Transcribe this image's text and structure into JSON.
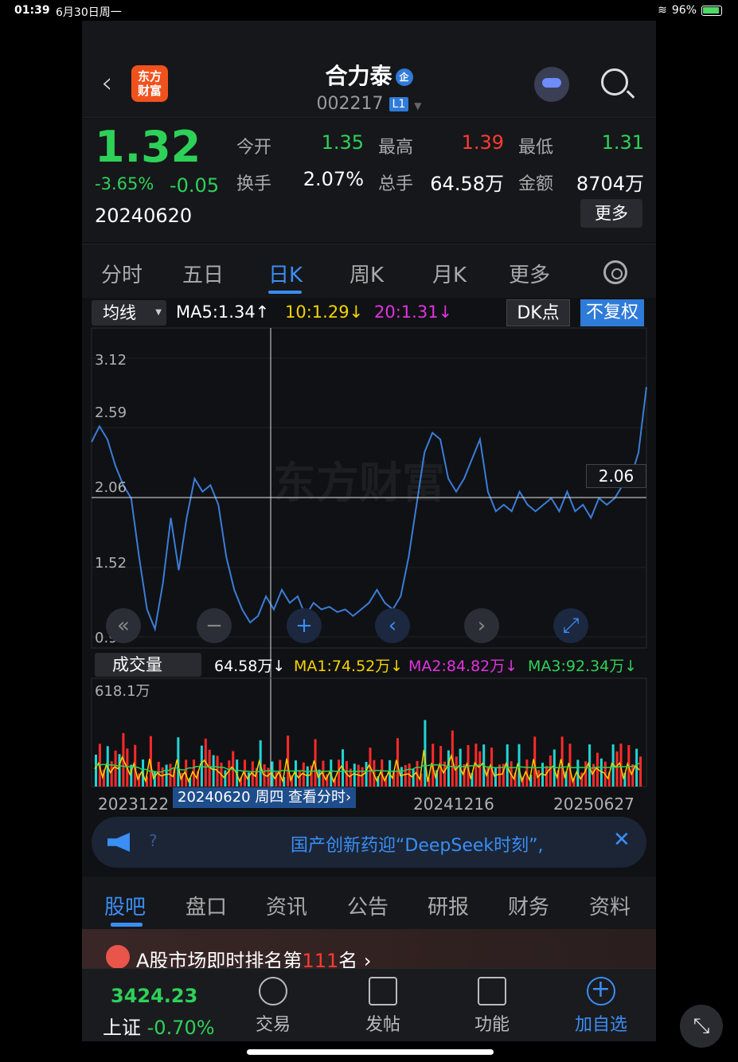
{
  "status": {
    "time": "01:39",
    "date": "6月30日周一",
    "battery": "96%"
  },
  "header": {
    "back": "‹",
    "logo_line1": "东方",
    "logo_line2": "财富",
    "title": "合力泰",
    "badge_qi": "企",
    "code": "002217",
    "level": "L1"
  },
  "quote": {
    "price": "1.32",
    "change_pct": "-3.65%",
    "change": "-0.05",
    "date": "20240620",
    "labels": {
      "open": "今开",
      "high": "最高",
      "low": "最低",
      "turnover": "换手",
      "volume": "总手",
      "amount": "金额"
    },
    "values": {
      "open": "1.35",
      "high": "1.39",
      "low": "1.31",
      "turnover": "2.07%",
      "volume": "64.58万",
      "amount": "8704万"
    },
    "more": "更多"
  },
  "ktabs": [
    "分时",
    "五日",
    "日K",
    "周K",
    "月K",
    "更多"
  ],
  "ma_bar": {
    "selector": "均线",
    "ma5": "MA5:1.34↑",
    "ma10": "10:1.29↓",
    "ma20": "20:1.31↓",
    "dk": "DK点",
    "fuquan": "不复权",
    "ma10_color": "#f5d300",
    "ma20_color": "#e033e0"
  },
  "price_axis": [
    "3.12",
    "2.59",
    "2.06",
    "1.52",
    "0.99"
  ],
  "crosshair_value": "2.06",
  "watermark": "东方财富",
  "vol_bar": {
    "selector": "成交量",
    "vol": "64.58万↓",
    "ma1": "MA1:74.52万↓",
    "ma2": "MA2:84.82万↓",
    "ma3": "MA3:92.34万↓"
  },
  "vol_axis_max": "618.1万",
  "date_axis": [
    "2023122",
    "20241216",
    "20250627"
  ],
  "cursor_date": "20240620 周四 查看分时›",
  "banner": {
    "text": "国产创新药迎“DeepSeek时刻”,",
    "close": "✕",
    "q": "?"
  },
  "subtabs": [
    "股吧",
    "盘口",
    "资讯",
    "公告",
    "研报",
    "财务",
    "资料"
  ],
  "rank": {
    "text": "A股市场即时排名第",
    "num": "111",
    "suffix": "名 ›"
  },
  "bottom": {
    "index_value": "3424.23",
    "index_name": "上证",
    "index_pct": "-0.70%",
    "items": [
      "交易",
      "发帖",
      "功能",
      "加自选"
    ]
  },
  "chart_data": {
    "type": "line",
    "ylim": [
      0.99,
      3.12
    ],
    "y_ticks": [
      3.12,
      2.59,
      2.06,
      1.52,
      0.99
    ],
    "x_labels": [
      "2023122",
      "20241216",
      "20250627"
    ],
    "price": [
      2.48,
      2.6,
      2.5,
      2.3,
      2.15,
      2.05,
      1.6,
      1.2,
      1.05,
      1.4,
      1.9,
      1.5,
      1.9,
      2.2,
      2.1,
      2.15,
      2.0,
      1.6,
      1.35,
      1.2,
      1.1,
      1.15,
      1.3,
      1.2,
      1.35,
      1.25,
      1.3,
      1.15,
      1.25,
      1.2,
      1.22,
      1.18,
      1.2,
      1.15,
      1.2,
      1.25,
      1.35,
      1.25,
      1.2,
      1.3,
      1.6,
      2.0,
      2.4,
      2.55,
      2.5,
      2.2,
      2.1,
      2.2,
      2.35,
      2.5,
      2.1,
      1.95,
      2.0,
      1.95,
      2.1,
      2.0,
      1.95,
      2.0,
      2.05,
      1.95,
      2.1,
      1.95,
      2.0,
      1.9,
      2.05,
      2.0,
      2.05,
      2.15,
      2.2,
      2.4,
      2.9
    ]
  }
}
